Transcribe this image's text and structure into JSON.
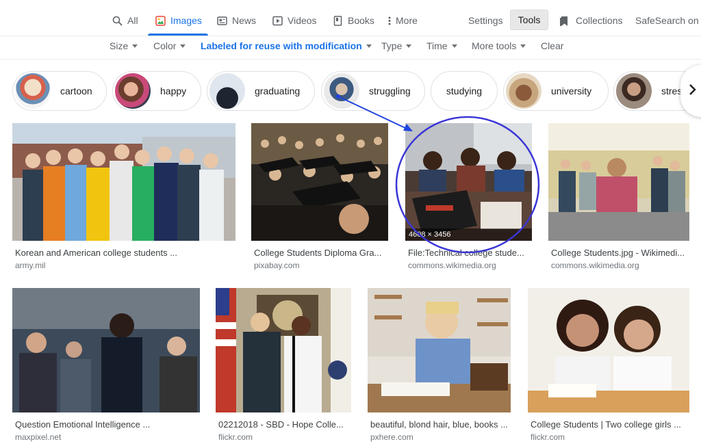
{
  "tabs": [
    {
      "label": "All",
      "icon": "search-icon"
    },
    {
      "label": "Images",
      "icon": "image-icon"
    },
    {
      "label": "News",
      "icon": "news-icon"
    },
    {
      "label": "Videos",
      "icon": "video-icon"
    },
    {
      "label": "Books",
      "icon": "book-icon"
    },
    {
      "label": "More",
      "icon": "more-vert-icon"
    }
  ],
  "settings_label": "Settings",
  "tools_label": "Tools",
  "collections_label": "Collections",
  "safesearch_label": "SafeSearch on",
  "filters": [
    {
      "label": "Size"
    },
    {
      "label": "Color"
    },
    {
      "label": "Labeled for reuse with modification"
    },
    {
      "label": "Type"
    },
    {
      "label": "Time"
    },
    {
      "label": "More tools"
    }
  ],
  "clear_label": "Clear",
  "chips": [
    {
      "label": "cartoon"
    },
    {
      "label": "happy"
    },
    {
      "label": "graduating"
    },
    {
      "label": "struggling"
    },
    {
      "label": "studying"
    },
    {
      "label": "university"
    },
    {
      "label": "stress"
    }
  ],
  "results": [
    {
      "title": "Korean and American college students ...",
      "source": "army.mil"
    },
    {
      "title": "College Students Diploma Gra...",
      "source": "pixabay.com"
    },
    {
      "title": "File:Technical college stude...",
      "source": "commons.wikimedia.org",
      "dimensions": "4608 × 3456"
    },
    {
      "title": "College Students.jpg - Wikimedi...",
      "source": "commons.wikimedia.org"
    },
    {
      "title": "Question Emotional Intelligence ...",
      "source": "maxpixel.net"
    },
    {
      "title": "02212018 - SBD - Hope Colle...",
      "source": "flickr.com"
    },
    {
      "title": "beautiful, blond hair, blue, books ...",
      "source": "pxhere.com"
    },
    {
      "title": "College Students | Two college girls ...",
      "source": "flickr.com"
    }
  ],
  "colors": {
    "accent": "#1a73e8",
    "annotation": "#3b36d6",
    "arrow": "#1f43e0"
  }
}
